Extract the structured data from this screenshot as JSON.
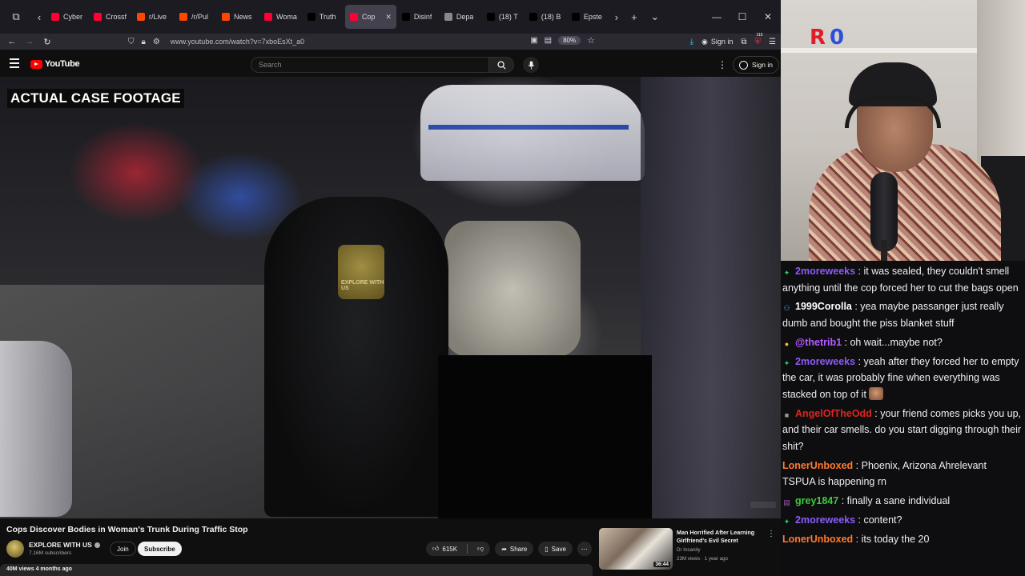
{
  "browser": {
    "tabs": [
      {
        "title": "Cyber",
        "favicon_color": "#ff0033"
      },
      {
        "title": "Crossf",
        "favicon_color": "#ff0033"
      },
      {
        "title": "r/Live",
        "favicon_color": "#ff4500"
      },
      {
        "title": "/r/Pul",
        "favicon_color": "#ff4500"
      },
      {
        "title": "News",
        "favicon_color": "#ff4500"
      },
      {
        "title": "Woma",
        "favicon_color": "#ff0033"
      },
      {
        "title": "Truth",
        "favicon_color": "#000000"
      },
      {
        "title": "Cop",
        "favicon_color": "#ff0033",
        "active": true
      },
      {
        "title": "Disinf",
        "favicon_color": "#000000"
      },
      {
        "title": "Depa",
        "favicon_color": "#888888"
      },
      {
        "title": "(18) T",
        "favicon_color": "#000000"
      },
      {
        "title": "(18) B",
        "favicon_color": "#000000"
      },
      {
        "title": "Epste",
        "favicon_color": "#000000"
      }
    ],
    "url": "www.youtube.com/watch?v=7xboEsXt_a0",
    "zoom": "80%",
    "signin_label": "Sign in",
    "extension_badge": "115"
  },
  "youtube": {
    "logo_text": "YouTube",
    "search_placeholder": "Search",
    "signin_label": "Sign in",
    "video": {
      "caption": "ACTUAL CASE FOOTAGE",
      "patch_text": "EXPLORE WITH US"
    },
    "title": "Cops Discover Bodies in Woman's Trunk During Traffic Stop",
    "channel": {
      "name": "EXPLORE WITH US",
      "subscribers": "7.16M subscribers",
      "join_label": "Join",
      "subscribe_label": "Subscribe"
    },
    "actions": {
      "likes": "615K",
      "share_label": "Share",
      "save_label": "Save"
    },
    "meta": "40M views  4 months ago",
    "recommended": {
      "title": "Man Horrified After Learning Girlfriend's Evil Secret",
      "channel": "Dr Insanity",
      "views": "23M views · 1 year ago",
      "duration": "36:44"
    }
  },
  "stream": {
    "overlay_logo_left": "R",
    "overlay_logo_right": "0"
  },
  "chat": {
    "messages": [
      {
        "user": "2moreweeks",
        "color": "#8a5cf6",
        "badge": "✦",
        "badge_color": "#2ecc71",
        "text": "it was sealed, they couldn't smell anything until the cop forced her to cut the bags open"
      },
      {
        "user": "1999Corolla",
        "color": "#ffffff",
        "badge": "⚇",
        "badge_color": "#3ea6ff",
        "text": "yea maybe passanger just really dumb and bought the piss blanket stuff"
      },
      {
        "user": "@thetrib1",
        "color": "#b35cff",
        "badge": "●",
        "badge_color": "#f1c40f",
        "text": "oh wait...maybe not?"
      },
      {
        "user": "2moreweeks",
        "color": "#8a5cf6",
        "badge": "✦",
        "badge_color": "#2ecc71",
        "text": "yeah after they forced her to empty the car, it was probably fine when everything was stacked on top of it"
      },
      {
        "user": "AngelOfTheOdd",
        "color": "#e0241f",
        "badge": "■",
        "badge_color": "#999999",
        "text": "your friend comes picks you up, and their car smells. do you start digging through their shit?"
      },
      {
        "user": "LonerUnboxed",
        "color": "#ff7a2e",
        "badge": "",
        "badge_color": "",
        "text": "Phoenix, Arizona Ahrelevant TSPUA is happening rn"
      },
      {
        "user": "grey1847",
        "color": "#3fc93f",
        "badge": "▤",
        "badge_color": "#9b59b6",
        "text": "finally a sane individual"
      },
      {
        "user": "2moreweeks",
        "color": "#8a5cf6",
        "badge": "✦",
        "badge_color": "#2ecc71",
        "text": "content?"
      },
      {
        "user": "LonerUnboxed",
        "color": "#ff7a2e",
        "badge": "",
        "badge_color": "",
        "text": "its today the 20"
      }
    ]
  }
}
